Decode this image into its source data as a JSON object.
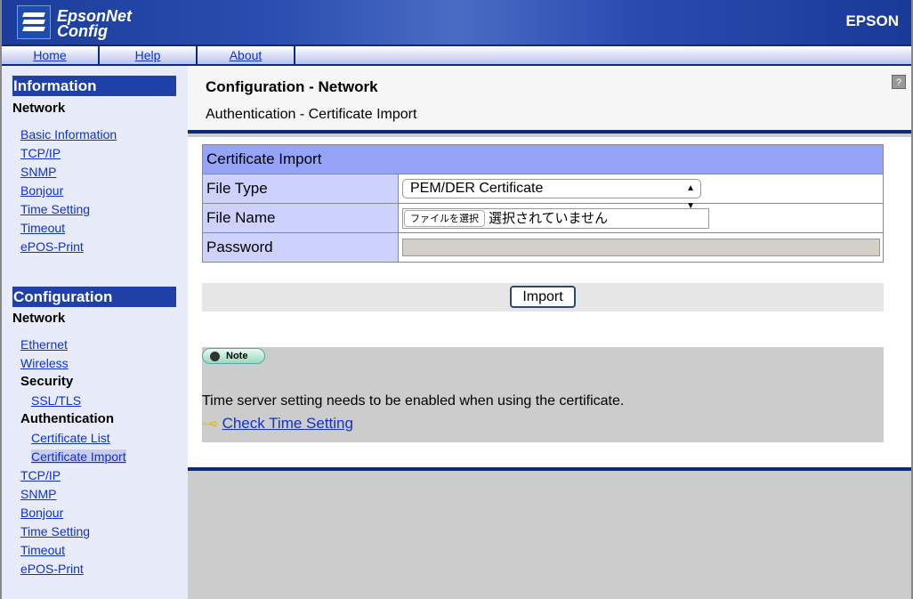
{
  "header": {
    "logo_line1": "EpsonNet",
    "logo_line2": "Config",
    "brand": "EPSON"
  },
  "nav": [
    {
      "label": "Home"
    },
    {
      "label": "Help"
    },
    {
      "label": "About"
    }
  ],
  "sidebar": {
    "information": {
      "title": "Information",
      "subtitle": "Network",
      "items": [
        "Basic Information",
        "TCP/IP",
        "SNMP",
        "Bonjour",
        "Time Setting",
        "Timeout",
        "ePOS-Print"
      ]
    },
    "configuration": {
      "title": "Configuration",
      "subtitle": "Network",
      "items": [
        "Ethernet",
        "Wireless"
      ],
      "security": {
        "label": "Security",
        "items": [
          "SSL/TLS"
        ]
      },
      "authentication": {
        "label": "Authentication",
        "items": [
          "Certificate List",
          "Certificate Import"
        ]
      },
      "more_items": [
        "TCP/IP",
        "SNMP",
        "Bonjour",
        "Time Setting",
        "Timeout",
        "ePOS-Print"
      ]
    }
  },
  "main": {
    "title": "Configuration - Network",
    "subtitle": "Authentication - Certificate Import",
    "help": "?",
    "form": {
      "header": "Certificate Import",
      "file_type": {
        "label": "File Type",
        "value": "PEM/DER Certificate"
      },
      "file_name": {
        "label": "File Name",
        "button": "ファイルを選択",
        "status": "選択されていません"
      },
      "password": {
        "label": "Password",
        "value": ""
      }
    },
    "import_label": "Import",
    "note": {
      "badge": "Note",
      "text": "Time server setting needs to be enabled when using the certificate.",
      "link": "Check Time Setting"
    }
  }
}
